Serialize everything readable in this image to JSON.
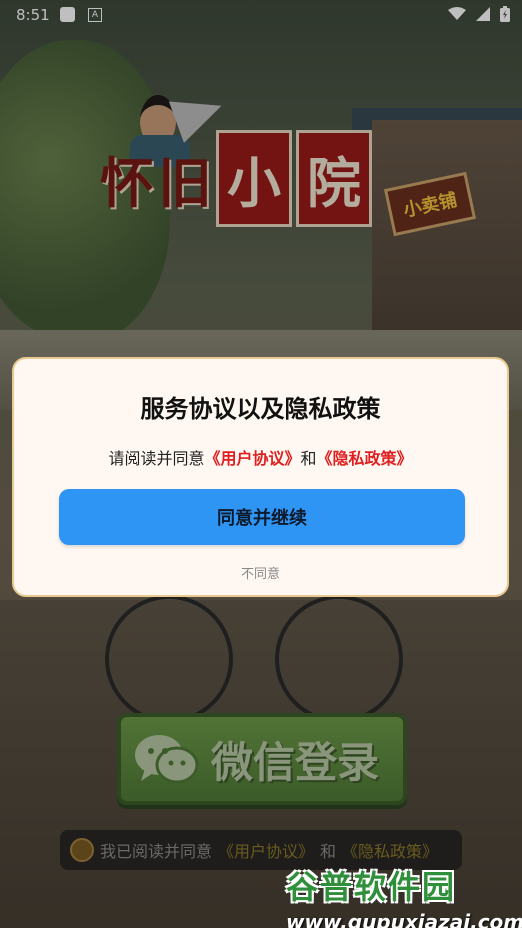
{
  "status_bar": {
    "time": "8:51",
    "notif_a": "A"
  },
  "background": {
    "logo_chars": [
      "怀",
      "旧",
      "小",
      "院"
    ],
    "shop_sign": "小卖铺"
  },
  "dialog": {
    "title": "服务协议以及隐私政策",
    "message_prefix": "请阅读并同意",
    "user_agreement_link": "《用户协议》",
    "conjunction": "和",
    "privacy_link": "《隐私政策》",
    "agree_button": "同意并继续",
    "disagree_button": "不同意"
  },
  "login": {
    "wechat_button": "微信登录",
    "consent_prefix": "我已阅读并同意",
    "consent_user_agreement": "《用户协议》",
    "consent_conjunction": "和",
    "consent_privacy": "《隐私政策》"
  },
  "watermark": {
    "title": "谷普软件园",
    "url": "www.gupuxiazai.com"
  },
  "colors": {
    "agree_button": "#2f95f5",
    "link_red": "#e02020",
    "wechat_green": "#5b8a3e",
    "dialog_bg": "#fff8f2",
    "dialog_border": "#e9c98f"
  }
}
